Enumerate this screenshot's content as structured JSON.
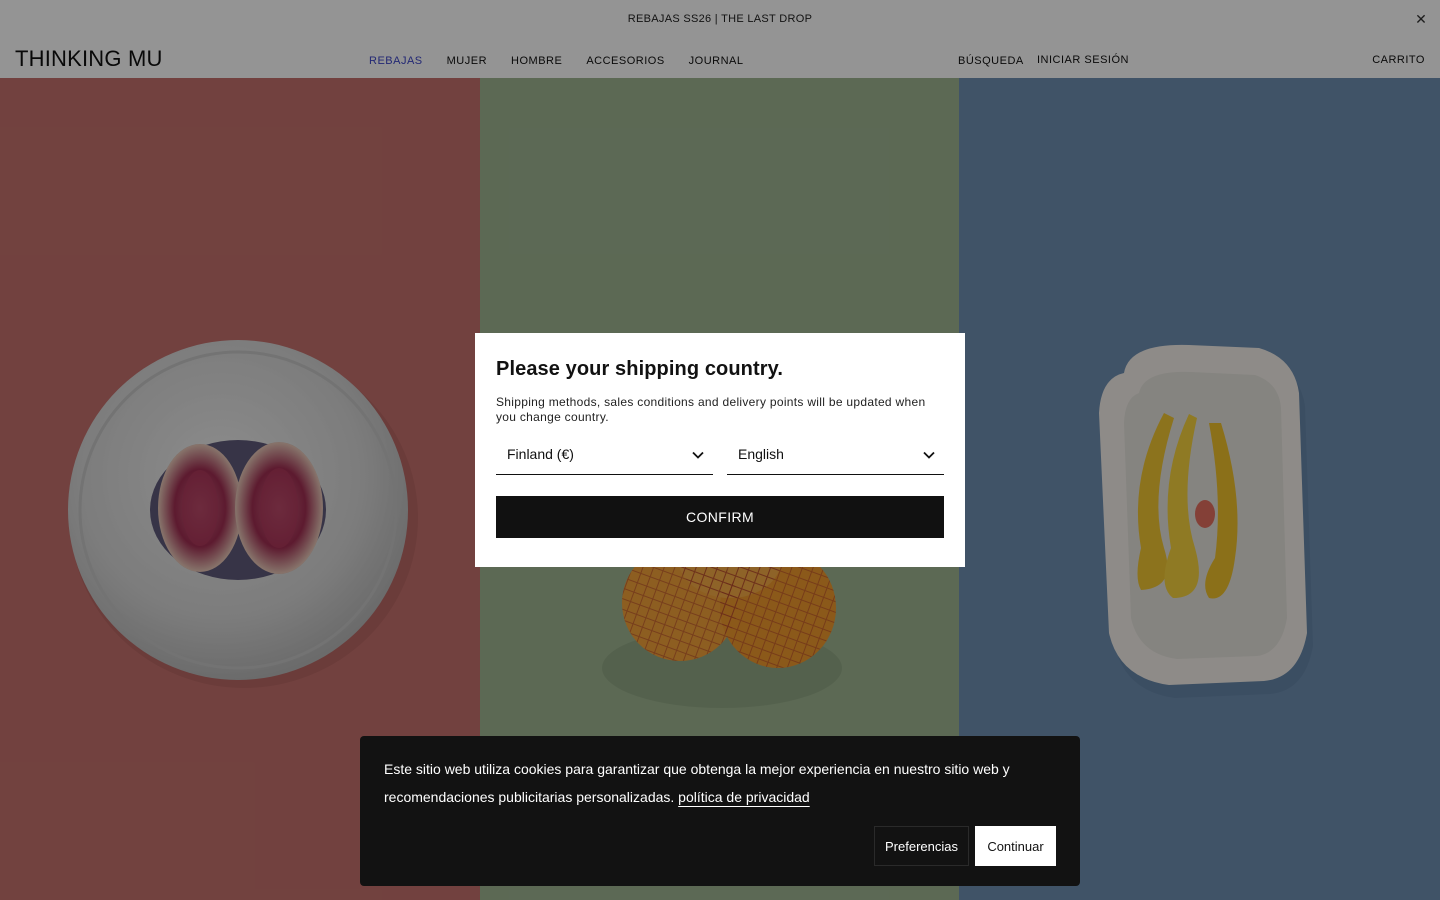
{
  "announcement": {
    "text": "REBAJAS SS26 | THE LAST DROP",
    "close_icon": "close-icon"
  },
  "header": {
    "logo": "THINKING MU",
    "nav": [
      "REBAJAS",
      "MUJER",
      "HOMBRE",
      "ACCESORIOS",
      "JOURNAL"
    ],
    "search": "BÚSQUEDA",
    "login": "INICIAR SESIÓN",
    "cart": "CARRITO"
  },
  "hero": {
    "panels": [
      {
        "subject": "halved fig on steel plate",
        "background_color": "#c5716d"
      },
      {
        "subject": "oranges in net bag",
        "background_color": "#9fb592"
      },
      {
        "subject": "bananas on ceramic tray",
        "background_color": "#6f8fb2"
      }
    ]
  },
  "modal": {
    "title": "Please your shipping country.",
    "description": "Shipping methods, sales conditions and delivery points will be updated when you change country.",
    "country_selected": "Finland (€)",
    "language_selected": "English",
    "chevron_icon": "chevron-down-icon",
    "confirm_label": "CONFIRM"
  },
  "cookie_banner": {
    "text": "Este sitio web utiliza cookies para garantizar que obtenga la mejor experiencia en nuestro sitio web y recomendaciones publicitarias personalizadas.",
    "link": "política de privacidad",
    "preferences_label": "Preferencias",
    "continue_label": "Continuar"
  },
  "colors": {
    "sale_accent": "#3d46c9",
    "overlay": "rgba(0,0,0,0.42)",
    "cookie_bg": "#121212"
  }
}
